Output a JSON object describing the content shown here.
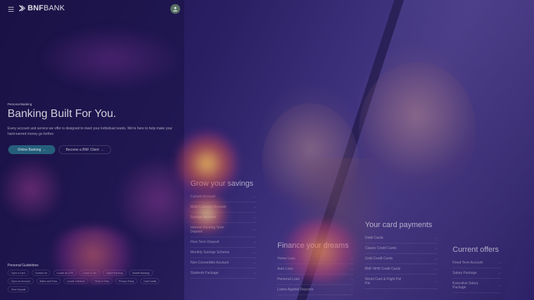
{
  "header": {
    "logo_bold": "BNF",
    "logo_light": "BANK",
    "menu_icon": "hamburger-menu-icon",
    "user_icon": "user-icon"
  },
  "hero": {
    "eyebrow": "Personal Banking",
    "title": "Banking Built For You.",
    "description": "Every account and service we offer is designed to meet your individual needs. We're here to help make your hard-earned money go further.",
    "primary_button": "Online Banking",
    "secondary_button": "Become a BNF Client",
    "accent_color": "#2a8ca0"
  },
  "guidelines": {
    "title": "Personal Guidelines",
    "chips": [
      "Open a Card",
      "Contact Us",
      "Locate an ATM",
      "Loans & Tax",
      "Digital Banking",
      "Mobile Banking",
      "Open an Account",
      "Rates and Fees",
      "Locate a Branch",
      "FAQs & Help",
      "Privacy Policy",
      "Card Limits",
      "Term Deposit"
    ]
  },
  "columns": {
    "savings": {
      "title": "Grow your savings",
      "items": [
        "Current Account",
        "Multi-Currency Account",
        "Savings Account",
        "Interest Banking Term Deposit",
        "Flexi Term Deposit",
        "Monthly Savings Scheme",
        "Non-Convertible Account",
        "Students Package"
      ]
    },
    "dreams": {
      "title": "Finance your dreams",
      "items": [
        "Home Loan",
        "Auto Loan",
        "Personal Loan",
        "Loans Against Deposits"
      ]
    },
    "cards": {
      "title": "Your card payments",
      "items": [
        "Debit Cards",
        "Classic Credit Cards",
        "Gold Credit Cards",
        "BNF NHB Credit Cards",
        "World Card & Flight Pal Pal"
      ]
    },
    "offers": {
      "title": "Current offers",
      "items": [
        "Fixed Term Account",
        "Salary Package",
        "Executive Salary Package"
      ]
    }
  }
}
